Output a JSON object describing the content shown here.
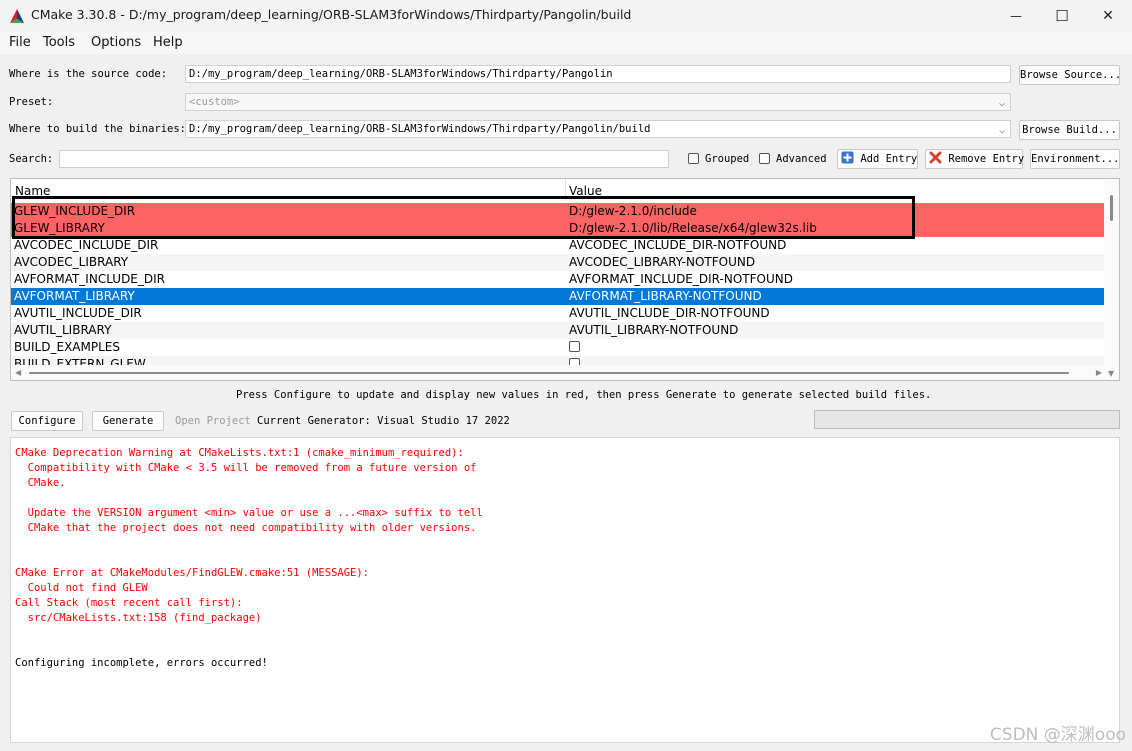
{
  "window": {
    "title": "CMake 3.30.8 - D:/my_program/deep_learning/ORB-SLAM3forWindows/Thirdparty/Pangolin/build",
    "minimize_glyph": "—",
    "maximize_glyph": "☐",
    "close_glyph": "✕"
  },
  "menu": {
    "file": "File",
    "tools": "Tools",
    "options": "Options",
    "help": "Help"
  },
  "source": {
    "label": "Where is the source code:",
    "value": "D:/my_program/deep_learning/ORB-SLAM3forWindows/Thirdparty/Pangolin",
    "browse": "Browse Source..."
  },
  "preset": {
    "label": "Preset:",
    "value": "<custom>"
  },
  "build": {
    "label": "Where to build the binaries:",
    "value": "D:/my_program/deep_learning/ORB-SLAM3forWindows/Thirdparty/Pangolin/build",
    "browse": "Browse Build..."
  },
  "search": {
    "label": "Search:",
    "value": "",
    "grouped": "Grouped",
    "advanced": "Advanced",
    "add_entry": "Add Entry",
    "remove_entry": "Remove Entry",
    "environment": "Environment..."
  },
  "table": {
    "col_name": "Name",
    "col_value": "Value",
    "rows": [
      {
        "name": "GLEW_INCLUDE_DIR",
        "value": "D:/glew-2.1.0/include",
        "state": "new"
      },
      {
        "name": "GLEW_LIBRARY",
        "value": "D:/glew-2.1.0/lib/Release/x64/glew32s.lib",
        "state": "new"
      },
      {
        "name": "AVCODEC_INCLUDE_DIR",
        "value": "AVCODEC_INCLUDE_DIR-NOTFOUND",
        "state": "normal"
      },
      {
        "name": "AVCODEC_LIBRARY",
        "value": "AVCODEC_LIBRARY-NOTFOUND",
        "state": "normal"
      },
      {
        "name": "AVFORMAT_INCLUDE_DIR",
        "value": "AVFORMAT_INCLUDE_DIR-NOTFOUND",
        "state": "normal"
      },
      {
        "name": "AVFORMAT_LIBRARY",
        "value": "AVFORMAT_LIBRARY-NOTFOUND",
        "state": "selected"
      },
      {
        "name": "AVUTIL_INCLUDE_DIR",
        "value": "AVUTIL_INCLUDE_DIR-NOTFOUND",
        "state": "normal"
      },
      {
        "name": "AVUTIL_LIBRARY",
        "value": "AVUTIL_LIBRARY-NOTFOUND",
        "state": "normal"
      },
      {
        "name": "BUILD_EXAMPLES",
        "value": "",
        "state": "checkbox"
      },
      {
        "name": "BUILD_EXTERN_GLEW",
        "value": "",
        "state": "checkbox"
      }
    ]
  },
  "hint": "Press Configure to update and display new values in red, then press Generate to generate selected build files.",
  "actions": {
    "configure": "Configure",
    "generate": "Generate",
    "open_project": "Open Project",
    "generator": "Current Generator: Visual Studio 17 2022"
  },
  "log": [
    {
      "text": "CMake Deprecation Warning at CMakeLists.txt:1 (cmake_minimum_required):",
      "color": "red"
    },
    {
      "text": "  Compatibility with CMake < 3.5 will be removed from a future version of",
      "color": "red"
    },
    {
      "text": "  CMake.",
      "color": "red"
    },
    {
      "text": "",
      "color": "red"
    },
    {
      "text": "  Update the VERSION argument <min> value or use a ...<max> suffix to tell",
      "color": "red"
    },
    {
      "text": "  CMake that the project does not need compatibility with older versions.",
      "color": "red"
    },
    {
      "text": "",
      "color": "red"
    },
    {
      "text": "",
      "color": "red"
    },
    {
      "text": "CMake Error at CMakeModules/FindGLEW.cmake:51 (MESSAGE):",
      "color": "red"
    },
    {
      "text": "  Could not find GLEW",
      "color": "red"
    },
    {
      "text": "Call Stack (most recent call first):",
      "color": "red"
    },
    {
      "text": "  src/CMakeLists.txt:158 (find_package)",
      "color": "red"
    },
    {
      "text": "",
      "color": "red"
    },
    {
      "text": "",
      "color": "red"
    },
    {
      "text": "Configuring incomplete, errors occurred!",
      "color": "black"
    }
  ],
  "watermark": "CSDN @深渊ooo",
  "colors": {
    "new_row": "#ff6464",
    "selected_row": "#0078d7",
    "log_red": "#ff0000"
  }
}
